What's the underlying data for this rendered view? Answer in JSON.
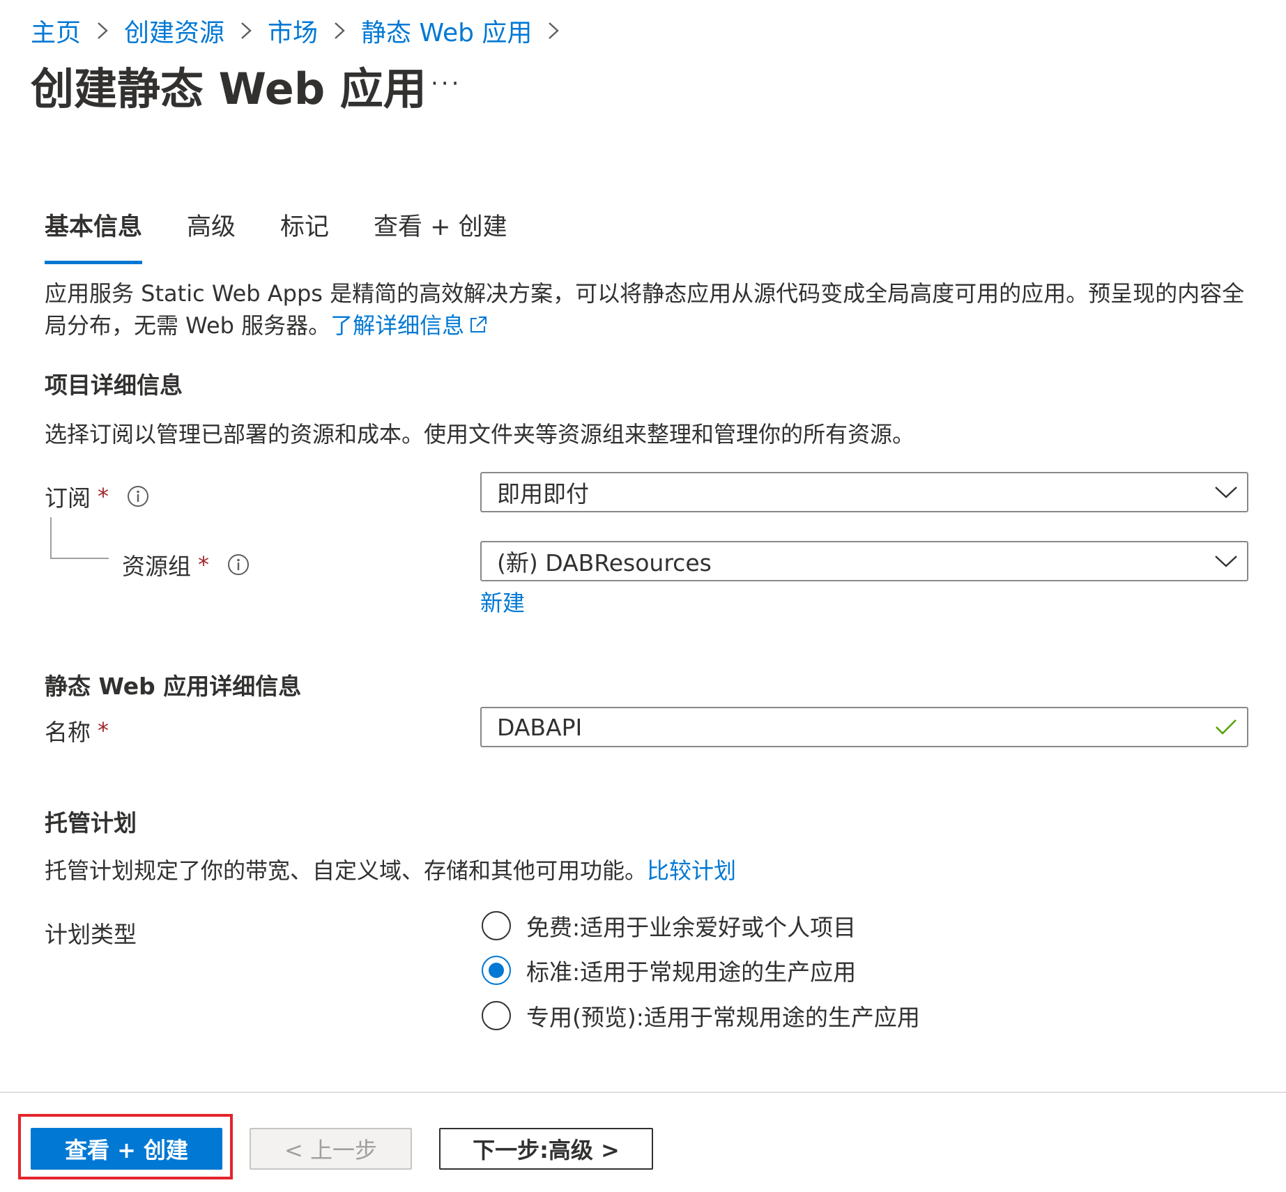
{
  "breadcrumb": {
    "items": [
      "主页",
      "创建资源",
      "市场",
      "静态 Web 应用"
    ]
  },
  "page": {
    "title": "创建静态 Web 应用",
    "more": "···"
  },
  "tabs": [
    {
      "label": "基本信息",
      "active": true
    },
    {
      "label": "高级",
      "active": false
    },
    {
      "label": "标记",
      "active": false
    },
    {
      "label": "查看 + 创建",
      "active": false
    }
  ],
  "intro": {
    "text": "应用服务 Static Web Apps 是精简的高效解决方案，可以将静态应用从源代码变成全局高度可用的应用。预呈现的内容全局分布，无需 Web 服务器。",
    "link": "了解详细信息"
  },
  "project": {
    "title": "项目详细信息",
    "description": "选择订阅以管理已部署的资源和成本。使用文件夹等资源组来整理和管理你的所有资源。",
    "subscription_label": "订阅",
    "subscription_value": "即用即付",
    "resource_group_label": "资源组",
    "resource_group_value": "(新) DABResources",
    "create_new_link": "新建",
    "required_mark": "*"
  },
  "app_details": {
    "title": "静态 Web 应用详细信息",
    "name_label": "名称",
    "name_value": "DABAPI"
  },
  "hosting": {
    "title": "托管计划",
    "description": "托管计划规定了你的带宽、自定义域、存储和其他可用功能。",
    "compare_link": "比较计划",
    "plan_type_label": "计划类型",
    "options": [
      {
        "label": "免费:适用于业余爱好或个人项目",
        "selected": false
      },
      {
        "label": "标准:适用于常规用途的生产应用",
        "selected": true
      },
      {
        "label": "专用(预览):适用于常规用途的生产应用",
        "selected": false
      }
    ]
  },
  "footer": {
    "review_create": "查看 + 创建",
    "previous": "< 上一步",
    "next": "下一步:高级 >"
  },
  "colors": {
    "accent": "#0078d4",
    "required": "#a4262c",
    "valid": "#57a300",
    "highlight_border": "#e3242b"
  }
}
